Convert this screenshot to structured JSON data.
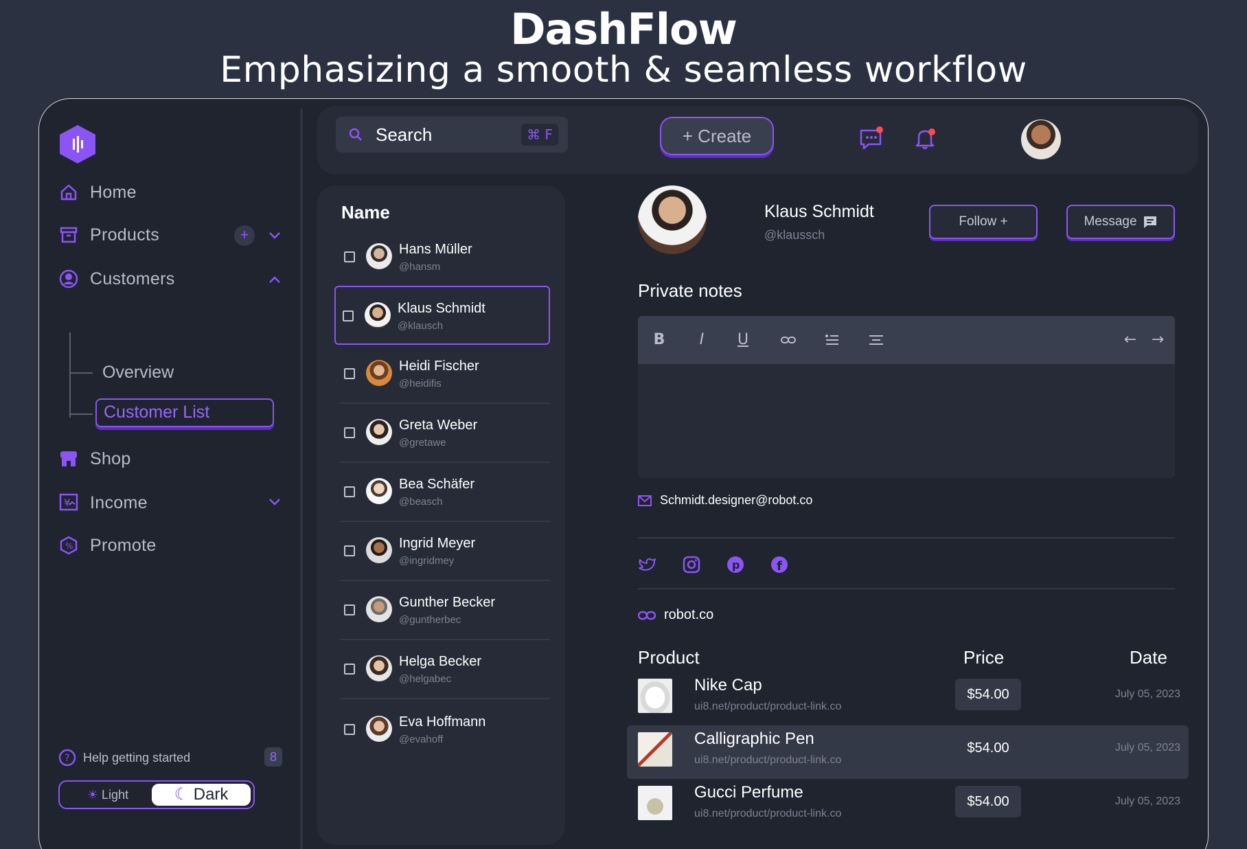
{
  "brand": {
    "title": "DashFlow",
    "subtitle": "Emphasizing a smooth & seamless workflow"
  },
  "colors": {
    "accent": "#8b55f6",
    "bg": "#1f242f",
    "panel": "#262b37"
  },
  "sidebar": {
    "items": [
      {
        "label": "Home",
        "icon": "home-icon"
      },
      {
        "label": "Products",
        "icon": "archive-box-icon"
      },
      {
        "label": "Customers",
        "icon": "user-circle-icon"
      },
      {
        "label": "Shop",
        "icon": "store-icon"
      },
      {
        "label": "Income",
        "icon": "yen-chart-icon"
      },
      {
        "label": "Promote",
        "icon": "discount-badge-icon"
      }
    ],
    "sub_items": [
      {
        "label": "Overview"
      },
      {
        "label": "Customer List"
      }
    ],
    "help_label": "Help getting started",
    "help_count": "8",
    "theme": {
      "light": "Light",
      "dark": "Dark",
      "selected": "Dark"
    }
  },
  "topbar": {
    "search_placeholder": "Search",
    "search_shortcut": "⌘ F",
    "create_label": "+ Create"
  },
  "customer_list": {
    "header": "Name",
    "rows": [
      {
        "name": "Hans Müller",
        "handle": "@hansm"
      },
      {
        "name": "Klaus Schmidt",
        "handle": "@klausch"
      },
      {
        "name": "Heidi Fischer",
        "handle": "@heidifis"
      },
      {
        "name": "Greta Weber",
        "handle": "@gretawe"
      },
      {
        "name": "Bea Schäfer",
        "handle": "@beasch"
      },
      {
        "name": "Ingrid Meyer",
        "handle": "@ingridmey"
      },
      {
        "name": "Gunther Becker",
        "handle": "@guntherbec"
      },
      {
        "name": "Helga Becker",
        "handle": "@helgabec"
      },
      {
        "name": "Eva Hoffmann",
        "handle": "@evahoff"
      }
    ]
  },
  "detail": {
    "name": "Klaus Schmidt",
    "handle": "@klaussch",
    "follow_label": "Follow +",
    "message_label": "Message",
    "notes_title": "Private notes",
    "email": "Schmidt.designer@robot.co",
    "website": "robot.co",
    "table_headers": {
      "product": "Product",
      "price": "Price",
      "date": "Date"
    },
    "products": [
      {
        "name": "Nike Cap",
        "link": "ui8.net/product/product-link.co",
        "price": "$54.00",
        "date": "July 05, 2023"
      },
      {
        "name": "Calligraphic Pen",
        "link": "ui8.net/product/product-link.co",
        "price": "$54.00",
        "date": "July 05, 2023"
      },
      {
        "name": "Gucci Perfume",
        "link": "ui8.net/product/product-link.co",
        "price": "$54.00",
        "date": "July 05, 2023"
      }
    ]
  }
}
